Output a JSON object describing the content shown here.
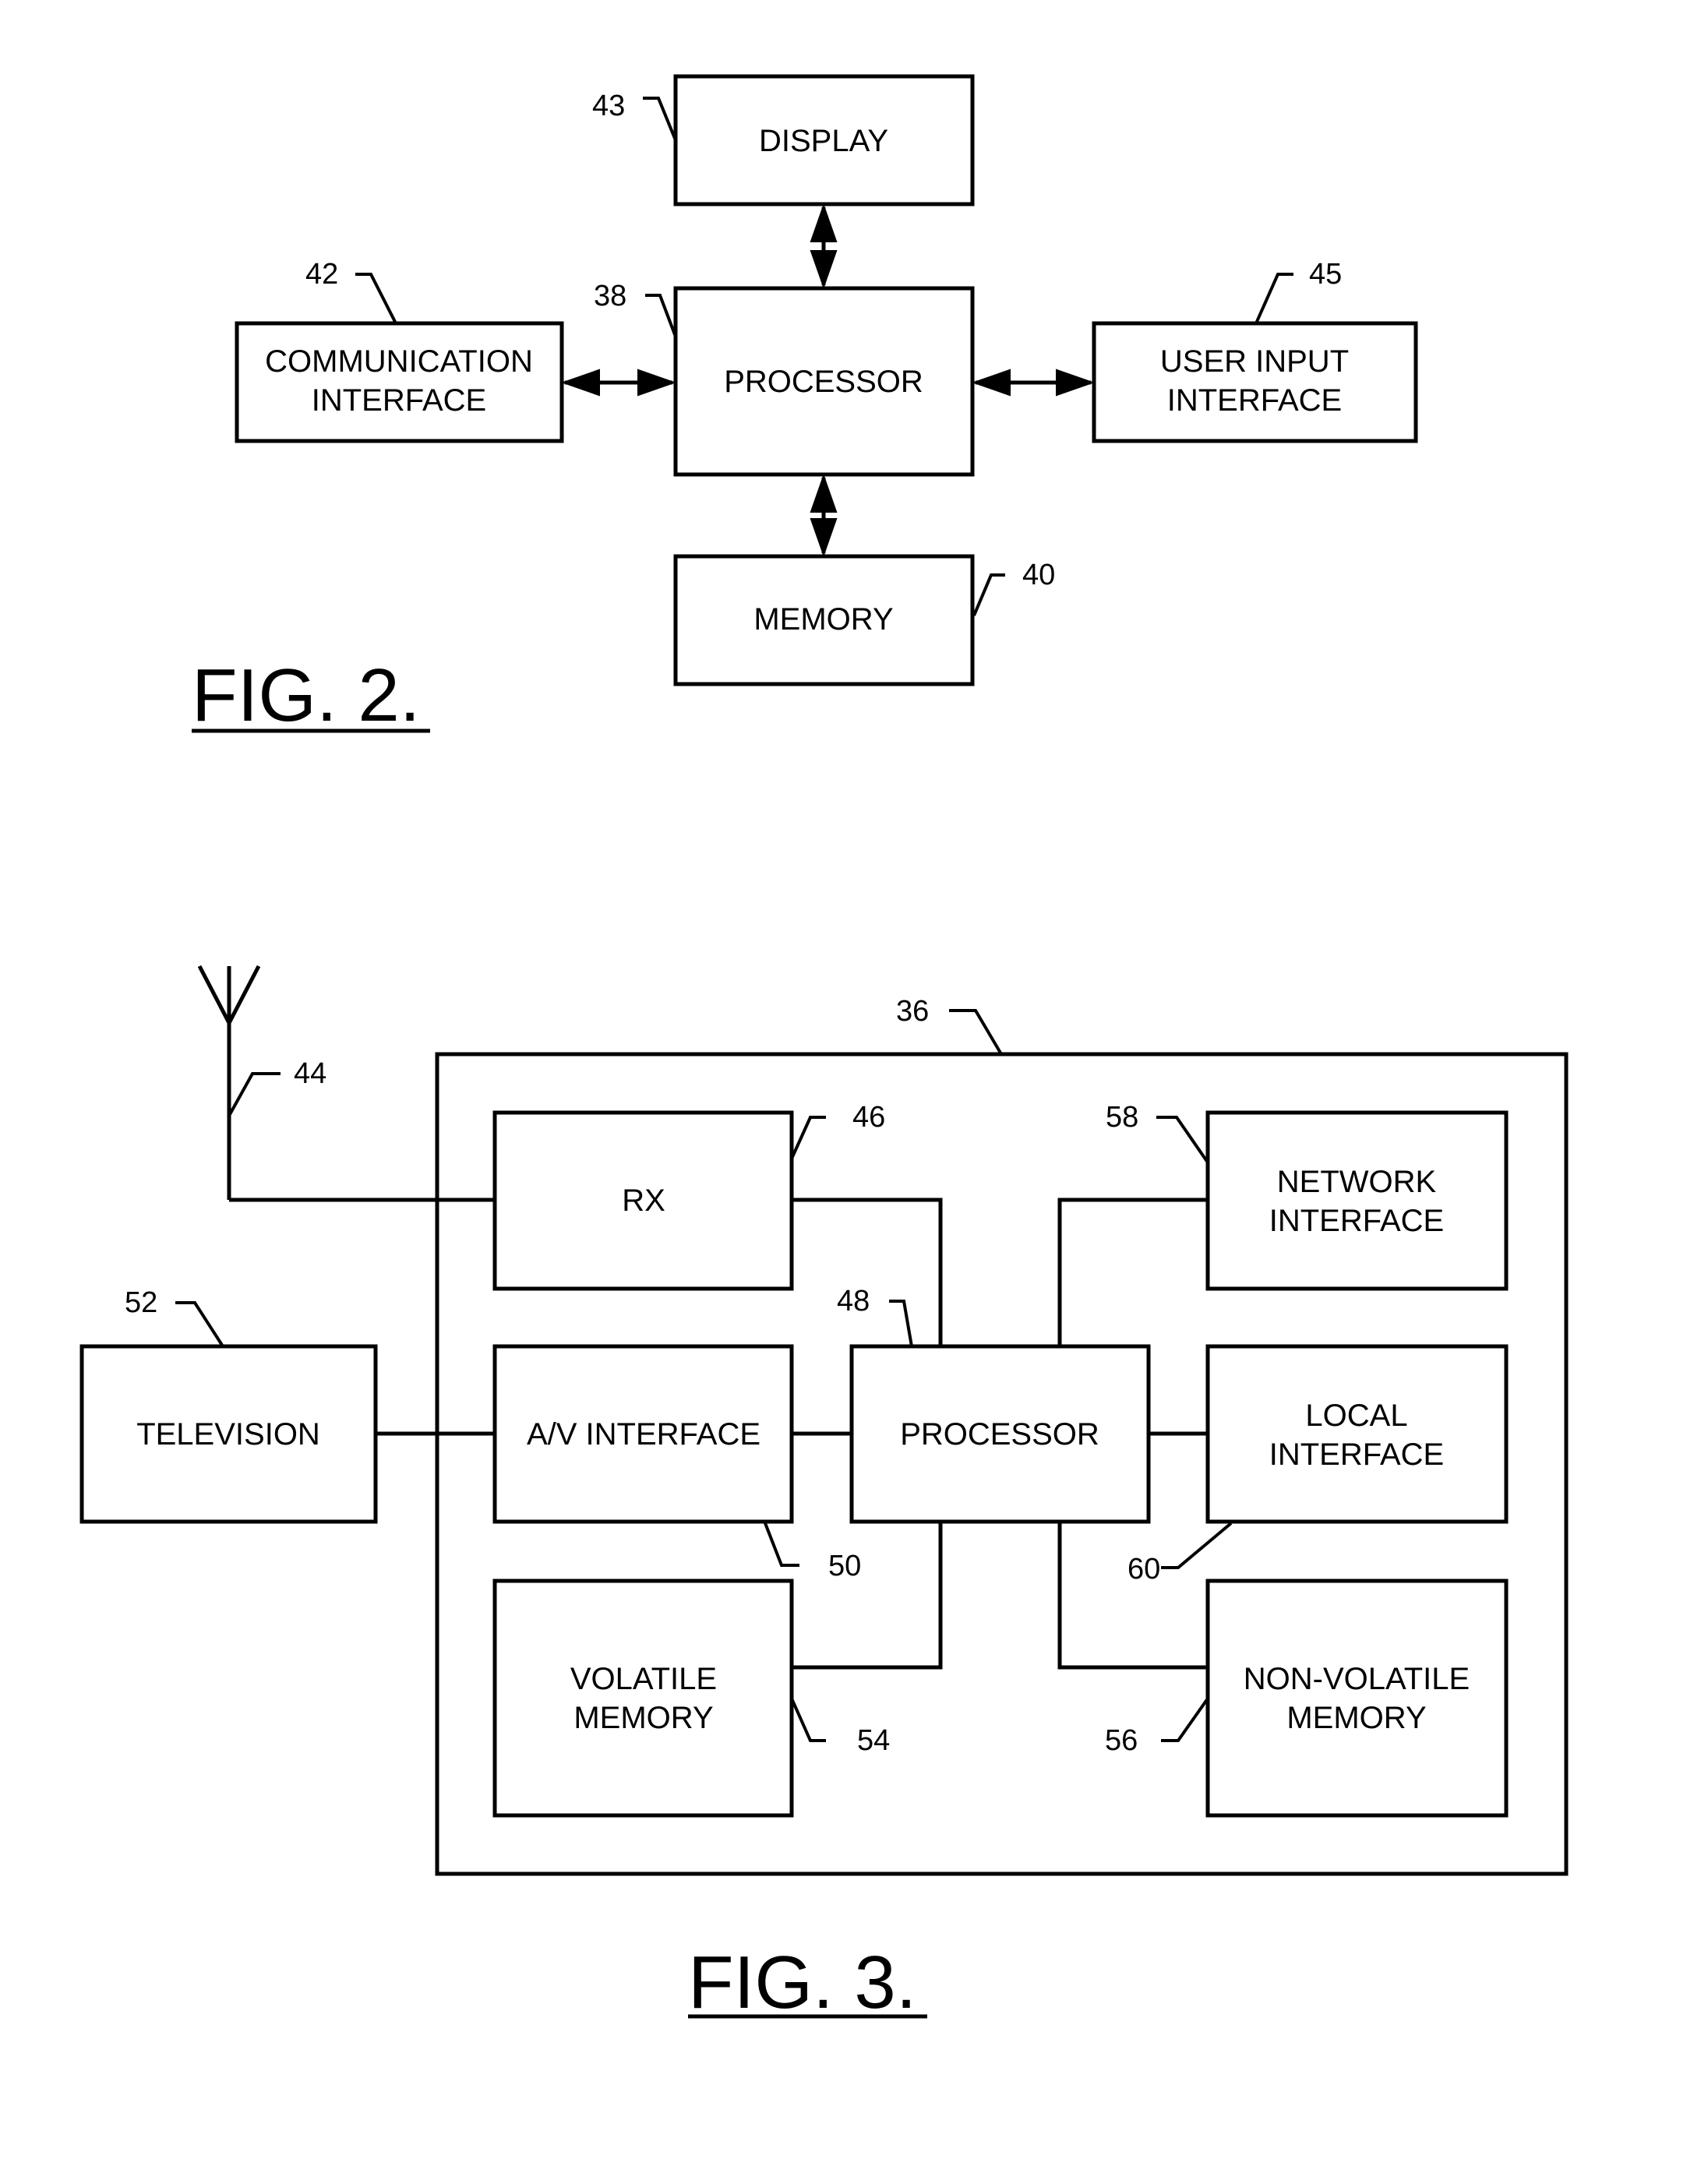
{
  "fig2": {
    "caption": "FIG. 2.",
    "blocks": {
      "display": {
        "lines": [
          "DISPLAY"
        ],
        "ref": "43"
      },
      "processor": {
        "lines": [
          "PROCESSOR"
        ],
        "ref": "38"
      },
      "memory": {
        "lines": [
          "MEMORY"
        ],
        "ref": "40"
      },
      "communication_interface": {
        "lines": [
          "COMMUNICATION",
          "INTERFACE"
        ],
        "ref": "42"
      },
      "user_input_interface": {
        "lines": [
          "USER INPUT",
          "INTERFACE"
        ],
        "ref": "45"
      }
    },
    "connections": [
      {
        "from": "processor",
        "to": "display",
        "type": "bidirectional-arrow"
      },
      {
        "from": "processor",
        "to": "memory",
        "type": "bidirectional-arrow"
      },
      {
        "from": "processor",
        "to": "communication_interface",
        "type": "bidirectional-arrow"
      },
      {
        "from": "processor",
        "to": "user_input_interface",
        "type": "bidirectional-arrow"
      }
    ]
  },
  "fig3": {
    "caption": "FIG. 3.",
    "device_ref": "36",
    "antenna_ref": "44",
    "blocks": {
      "rx": {
        "lines": [
          "RX"
        ],
        "ref": "46"
      },
      "av_interface": {
        "lines": [
          "A/V INTERFACE"
        ],
        "ref": "50"
      },
      "volatile_memory": {
        "lines": [
          "VOLATILE",
          "MEMORY"
        ],
        "ref": "54"
      },
      "processor": {
        "lines": [
          "PROCESSOR"
        ],
        "ref": "48"
      },
      "network_interface": {
        "lines": [
          "NETWORK",
          "INTERFACE"
        ],
        "ref": "58"
      },
      "local_interface": {
        "lines": [
          "LOCAL",
          "INTERFACE"
        ],
        "ref": "60"
      },
      "non_volatile_memory": {
        "lines": [
          "NON-VOLATILE",
          "MEMORY"
        ],
        "ref": "56"
      },
      "television": {
        "lines": [
          "TELEVISION"
        ],
        "ref": "52"
      }
    },
    "connections": [
      {
        "from": "antenna",
        "to": "rx",
        "type": "line"
      },
      {
        "from": "rx",
        "to": "processor",
        "type": "line"
      },
      {
        "from": "network_interface",
        "to": "processor",
        "type": "line"
      },
      {
        "from": "av_interface",
        "to": "processor",
        "type": "line"
      },
      {
        "from": "local_interface",
        "to": "processor",
        "type": "line"
      },
      {
        "from": "volatile_memory",
        "to": "processor",
        "type": "line"
      },
      {
        "from": "non_volatile_memory",
        "to": "processor",
        "type": "line"
      },
      {
        "from": "television",
        "to": "av_interface",
        "type": "line"
      }
    ]
  }
}
